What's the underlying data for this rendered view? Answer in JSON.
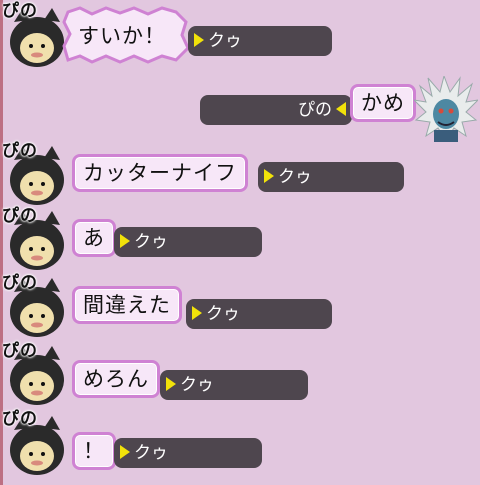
{
  "chat": {
    "messages": [
      {
        "speaker": "ぴの",
        "text": "すいか！",
        "reply_to": "クゥ"
      },
      {
        "speaker": "かめ",
        "text": "かめ",
        "reply_to": "ぴの"
      },
      {
        "speaker": "ぴの",
        "text": "カッターナイフ",
        "reply_to": "クゥ"
      },
      {
        "speaker": "ぴの",
        "text": "あ",
        "reply_to": "クゥ"
      },
      {
        "speaker": "ぴの",
        "text": "間違えた",
        "reply_to": "クゥ"
      },
      {
        "speaker": "ぴの",
        "text": "めろん",
        "reply_to": "クゥ"
      },
      {
        "speaker": "ぴの",
        "text": "！",
        "reply_to": "クゥ"
      }
    ]
  },
  "colors": {
    "background": "#e2c7df",
    "bubble_border": "#cf82d3",
    "target_bar": "#4e464e",
    "arrow": "#f1e20a"
  },
  "icons": {
    "player_avatar": "cat-hood-avatar-icon",
    "other_avatar": "white-hair-monster-avatar-icon"
  }
}
